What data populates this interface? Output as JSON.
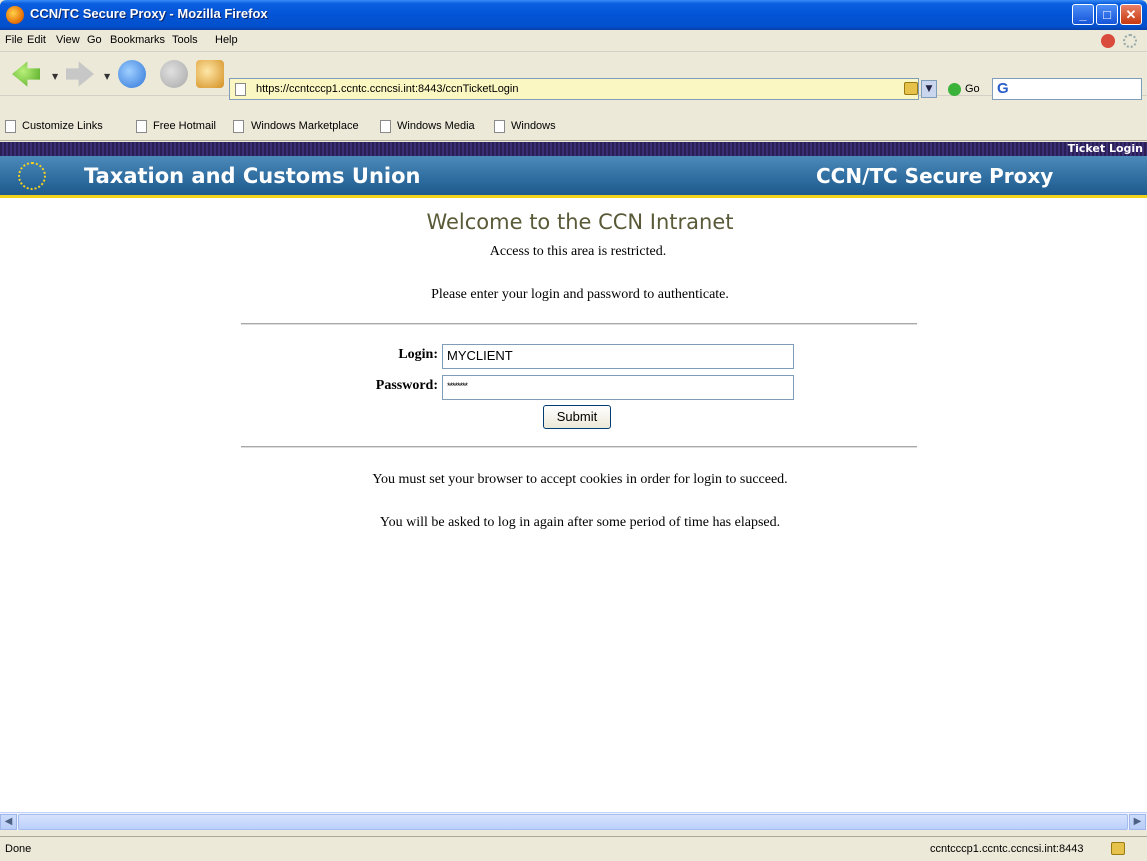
{
  "window": {
    "title": "CCN/TC Secure Proxy - Mozilla Firefox"
  },
  "menu": {
    "items": [
      "File",
      "Edit",
      "View",
      "Go",
      "Bookmarks",
      "Tools",
      "Help"
    ]
  },
  "navigation": {
    "url": "https://ccntcccp1.ccntc.ccncsi.int:8443/ccnTicketLogin",
    "go_label": "Go",
    "search_value": ""
  },
  "bookmarks": [
    "Customize Links",
    "Free Hotmail",
    "Windows Marketplace",
    "Windows Media",
    "Windows"
  ],
  "page": {
    "ticket_label": "Ticket Login",
    "banner_left": "Taxation and Customs Union",
    "banner_right": "CCN/TC Secure Proxy",
    "welcome": "Welcome to the CCN Intranet",
    "restricted": "Access to this area is restricted.",
    "instruction": "Please enter your login and password to authenticate.",
    "login_label": "Login:",
    "login_value": "MYCLIENT",
    "password_label": "Password:",
    "password_value": "********",
    "submit_label": "Submit",
    "note_cookies": "You must set your browser to accept cookies in order for login to succeed.",
    "note_timeout": "You will be asked to log in again after some period of time has elapsed."
  },
  "status": {
    "left": "Done",
    "right": "ccntcccp1.ccntc.ccncsi.int:8443"
  },
  "colors": {
    "banner": "#2e6c9f",
    "banner_accent": "#f2d31b",
    "welcome_text": "#5a5a38"
  }
}
